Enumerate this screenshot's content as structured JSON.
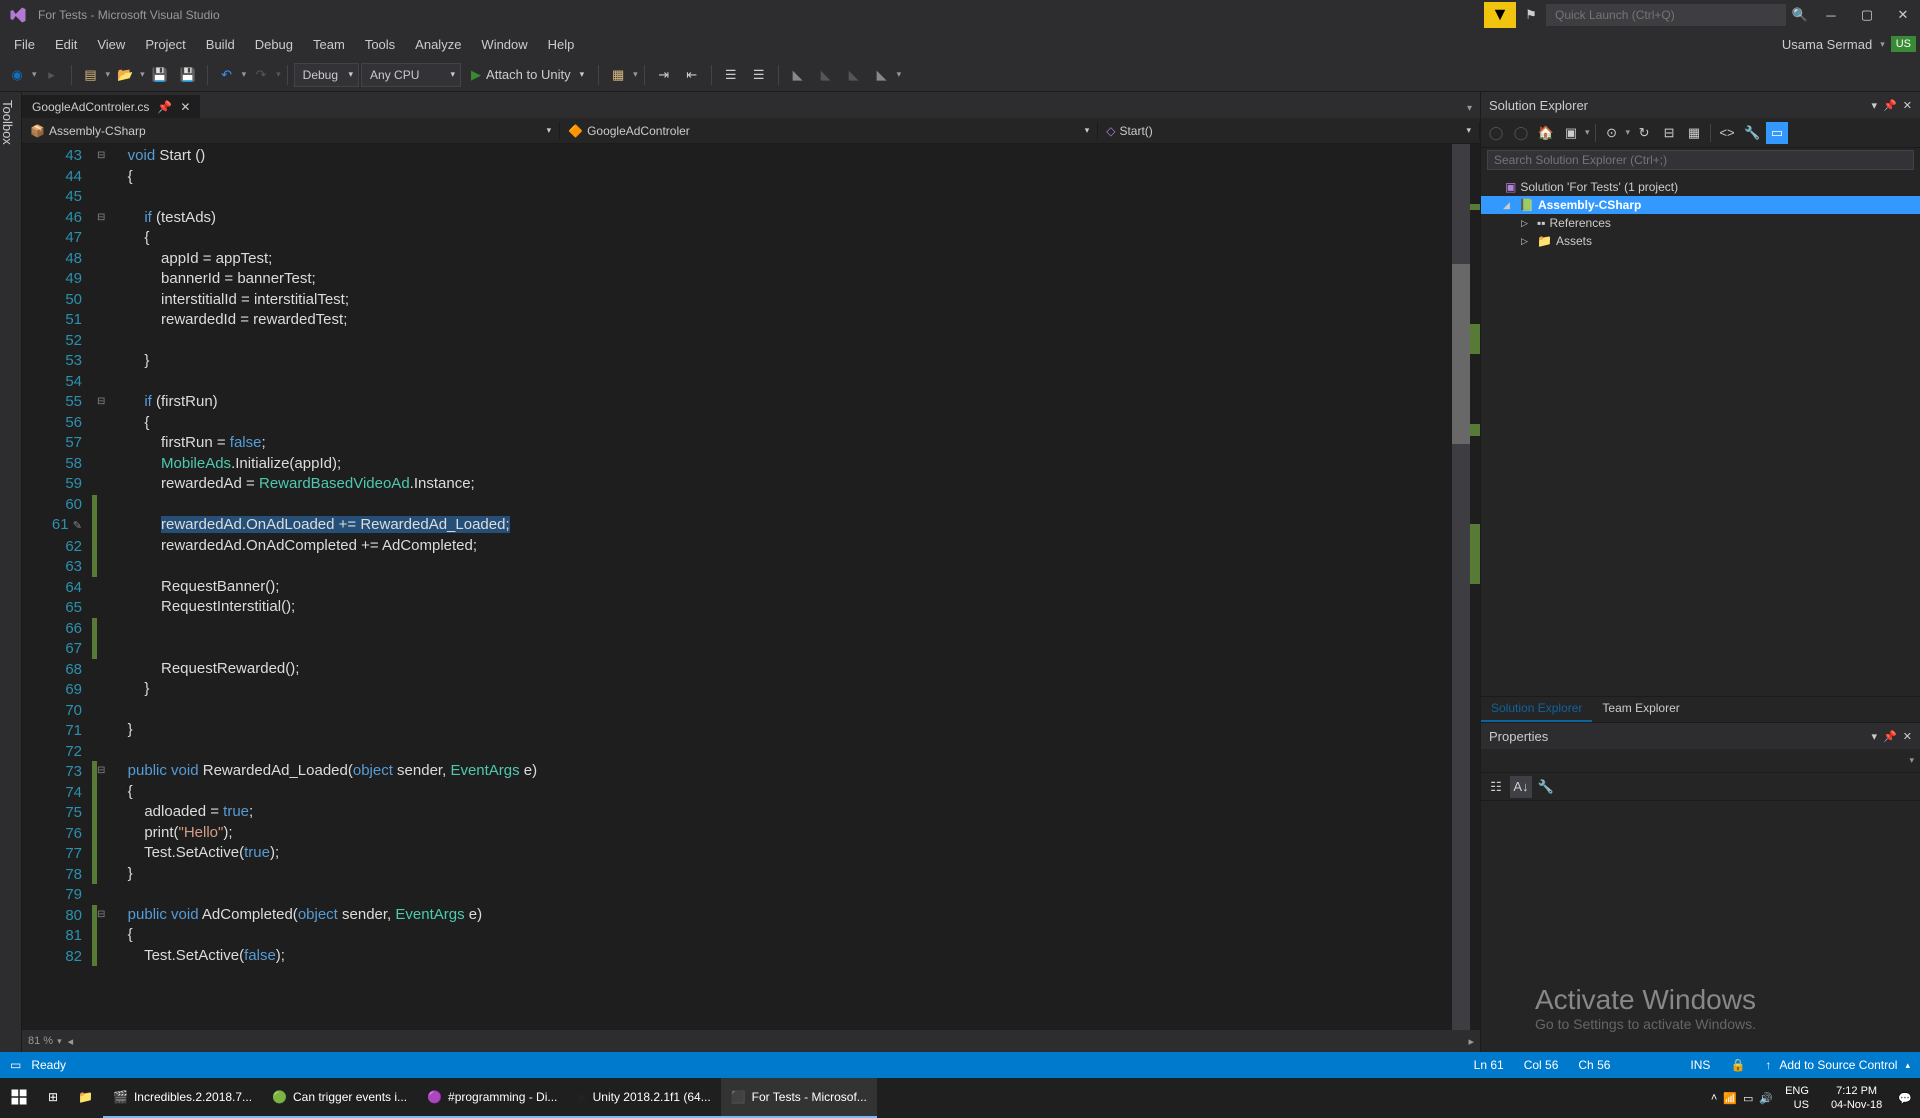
{
  "title": "For Tests - Microsoft Visual Studio",
  "quickLaunch": "Quick Launch (Ctrl+Q)",
  "menu": [
    "File",
    "Edit",
    "View",
    "Project",
    "Build",
    "Debug",
    "Team",
    "Tools",
    "Analyze",
    "Window",
    "Help"
  ],
  "user": "Usama Sermad",
  "userInitials": "US",
  "config": "Debug",
  "platform": "Any CPU",
  "runTarget": "Attach to Unity",
  "tab": "GoogleAdControler.cs",
  "nav1": "Assembly-CSharp",
  "nav2": "GoogleAdControler",
  "nav3": "Start()",
  "zoom": "81 %",
  "toolbox": "Toolbox",
  "solutionExplorer": {
    "title": "Solution Explorer",
    "search": "Search Solution Explorer (Ctrl+;)",
    "root": "Solution 'For Tests' (1 project)",
    "project": "Assembly-CSharp",
    "refs": "References",
    "assets": "Assets",
    "tab1": "Solution Explorer",
    "tab2": "Team Explorer"
  },
  "properties": {
    "title": "Properties"
  },
  "watermark": {
    "title": "Activate Windows",
    "sub": "Go to Settings to activate Windows."
  },
  "status": {
    "ready": "Ready",
    "ln": "Ln 61",
    "col": "Col 56",
    "ch": "Ch 56",
    "ins": "INS",
    "srcCtrl": "Add to Source Control"
  },
  "taskbar": {
    "items": [
      "Incredibles.2.2018.7...",
      "Can trigger events i...",
      "#programming - Di...",
      "Unity 2018.2.1f1 (64...",
      "For Tests - Microsof..."
    ],
    "lang": "ENG",
    "locale": "US",
    "time": "7:12 PM",
    "date": "04-Nov-18"
  },
  "code": {
    "startLine": 43,
    "lines": [
      {
        "n": 43,
        "t": "    void Start ()",
        "kw": [
          "void"
        ],
        "m": "n"
      },
      {
        "n": 44,
        "t": "    {",
        "m": "n"
      },
      {
        "n": 45,
        "t": "",
        "m": "n"
      },
      {
        "n": 46,
        "t": "        if (testAds)",
        "kw": [
          "if"
        ],
        "m": "n"
      },
      {
        "n": 47,
        "t": "        {",
        "m": "n"
      },
      {
        "n": 48,
        "t": "            appId = appTest;",
        "m": "n"
      },
      {
        "n": 49,
        "t": "            bannerId = bannerTest;",
        "m": "n"
      },
      {
        "n": 50,
        "t": "            interstitialId = interstitialTest;",
        "m": "n"
      },
      {
        "n": 51,
        "t": "            rewardedId = rewardedTest;",
        "m": "n"
      },
      {
        "n": 52,
        "t": "",
        "m": "n"
      },
      {
        "n": 53,
        "t": "        }",
        "m": "n"
      },
      {
        "n": 54,
        "t": "",
        "m": "n"
      },
      {
        "n": 55,
        "t": "        if (firstRun)",
        "kw": [
          "if"
        ],
        "m": "n"
      },
      {
        "n": 56,
        "t": "        {",
        "m": "n"
      },
      {
        "n": 57,
        "t": "            firstRun = false;",
        "kw": [
          "false"
        ],
        "m": "n"
      },
      {
        "n": 58,
        "t": "            MobileAds.Initialize(appId);",
        "ty": [
          "MobileAds"
        ],
        "m": "n"
      },
      {
        "n": 59,
        "t": "            rewardedAd = RewardBasedVideoAd.Instance;",
        "ty": [
          "RewardBasedVideoAd"
        ],
        "m": "n"
      },
      {
        "n": 60,
        "t": "",
        "m": "g"
      },
      {
        "n": 61,
        "t": "            rewardedAd.OnAdLoaded += RewardedAd_Loaded;",
        "sel": true,
        "m": "g",
        "pencil": true
      },
      {
        "n": 62,
        "t": "            rewardedAd.OnAdCompleted += AdCompleted;",
        "m": "g"
      },
      {
        "n": 63,
        "t": "",
        "m": "g"
      },
      {
        "n": 64,
        "t": "            RequestBanner();",
        "m": "n"
      },
      {
        "n": 65,
        "t": "            RequestInterstitial();",
        "m": "n"
      },
      {
        "n": 66,
        "t": "",
        "m": "g"
      },
      {
        "n": 67,
        "t": "",
        "m": "g"
      },
      {
        "n": 68,
        "t": "            RequestRewarded();",
        "m": "n"
      },
      {
        "n": 69,
        "t": "        }",
        "m": "n"
      },
      {
        "n": 70,
        "t": "",
        "m": "n"
      },
      {
        "n": 71,
        "t": "    }",
        "m": "n"
      },
      {
        "n": 72,
        "t": "",
        "m": "n"
      },
      {
        "n": 73,
        "t": "    public void RewardedAd_Loaded(object sender, EventArgs e)",
        "kw": [
          "public",
          "void",
          "object"
        ],
        "ty": [
          "EventArgs"
        ],
        "m": "g"
      },
      {
        "n": 74,
        "t": "    {",
        "m": "g"
      },
      {
        "n": 75,
        "t": "        adloaded = true;",
        "kw": [
          "true"
        ],
        "m": "g"
      },
      {
        "n": 76,
        "t": "        print(\"Hello\");",
        "str": [
          "\"Hello\""
        ],
        "m": "g"
      },
      {
        "n": 77,
        "t": "        Test.SetActive(true);",
        "kw": [
          "true"
        ],
        "m": "g"
      },
      {
        "n": 78,
        "t": "    }",
        "m": "g"
      },
      {
        "n": 79,
        "t": "",
        "m": "n"
      },
      {
        "n": 80,
        "t": "    public void AdCompleted(object sender, EventArgs e)",
        "kw": [
          "public",
          "void",
          "object"
        ],
        "ty": [
          "EventArgs"
        ],
        "m": "g"
      },
      {
        "n": 81,
        "t": "    {",
        "m": "g"
      },
      {
        "n": 82,
        "t": "        Test.SetActive(false);",
        "kw": [
          "false"
        ],
        "m": "g"
      }
    ]
  }
}
